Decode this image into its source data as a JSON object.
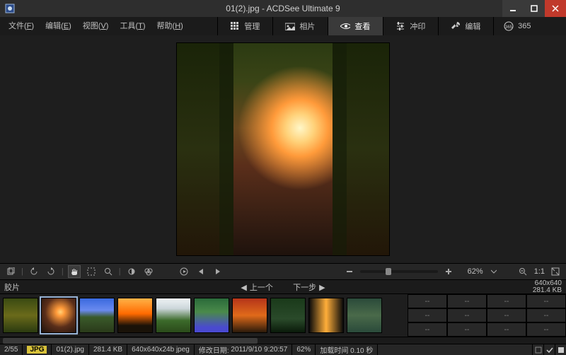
{
  "window": {
    "title": "01(2).jpg - ACDSee Ultimate 9"
  },
  "menu": {
    "file": {
      "label": "文件",
      "hotkey": "F"
    },
    "edit": {
      "label": "编辑",
      "hotkey": "E"
    },
    "view": {
      "label": "视图",
      "hotkey": "V"
    },
    "tools": {
      "label": "工具",
      "hotkey": "T"
    },
    "help": {
      "label": "帮助",
      "hotkey": "H"
    }
  },
  "modes": {
    "manage": "管理",
    "photos": "相片",
    "view": "查看",
    "develop": "冲印",
    "editmode": "编辑",
    "label365": "365",
    "active": "view"
  },
  "zoom": {
    "percent_label": "62%",
    "one_to_one": "1:1"
  },
  "filmstrip": {
    "title": "胶片",
    "prev_label": "上一个",
    "next_label": "下一步",
    "dims": "640x640",
    "size": "281.4 KB",
    "meta_placeholder": "--"
  },
  "status": {
    "counter": "2/55",
    "format_badge": "JPG",
    "filename": "01(2).jpg",
    "filesize": "281.4 KB",
    "dims": "640x640x24b jpeg",
    "modified_label": "修改日期:",
    "modified_value": "2011/9/10 9:20:57",
    "zoom": "62%",
    "loadtime_label": "加载时间",
    "loadtime_value": "0.10 秒"
  }
}
